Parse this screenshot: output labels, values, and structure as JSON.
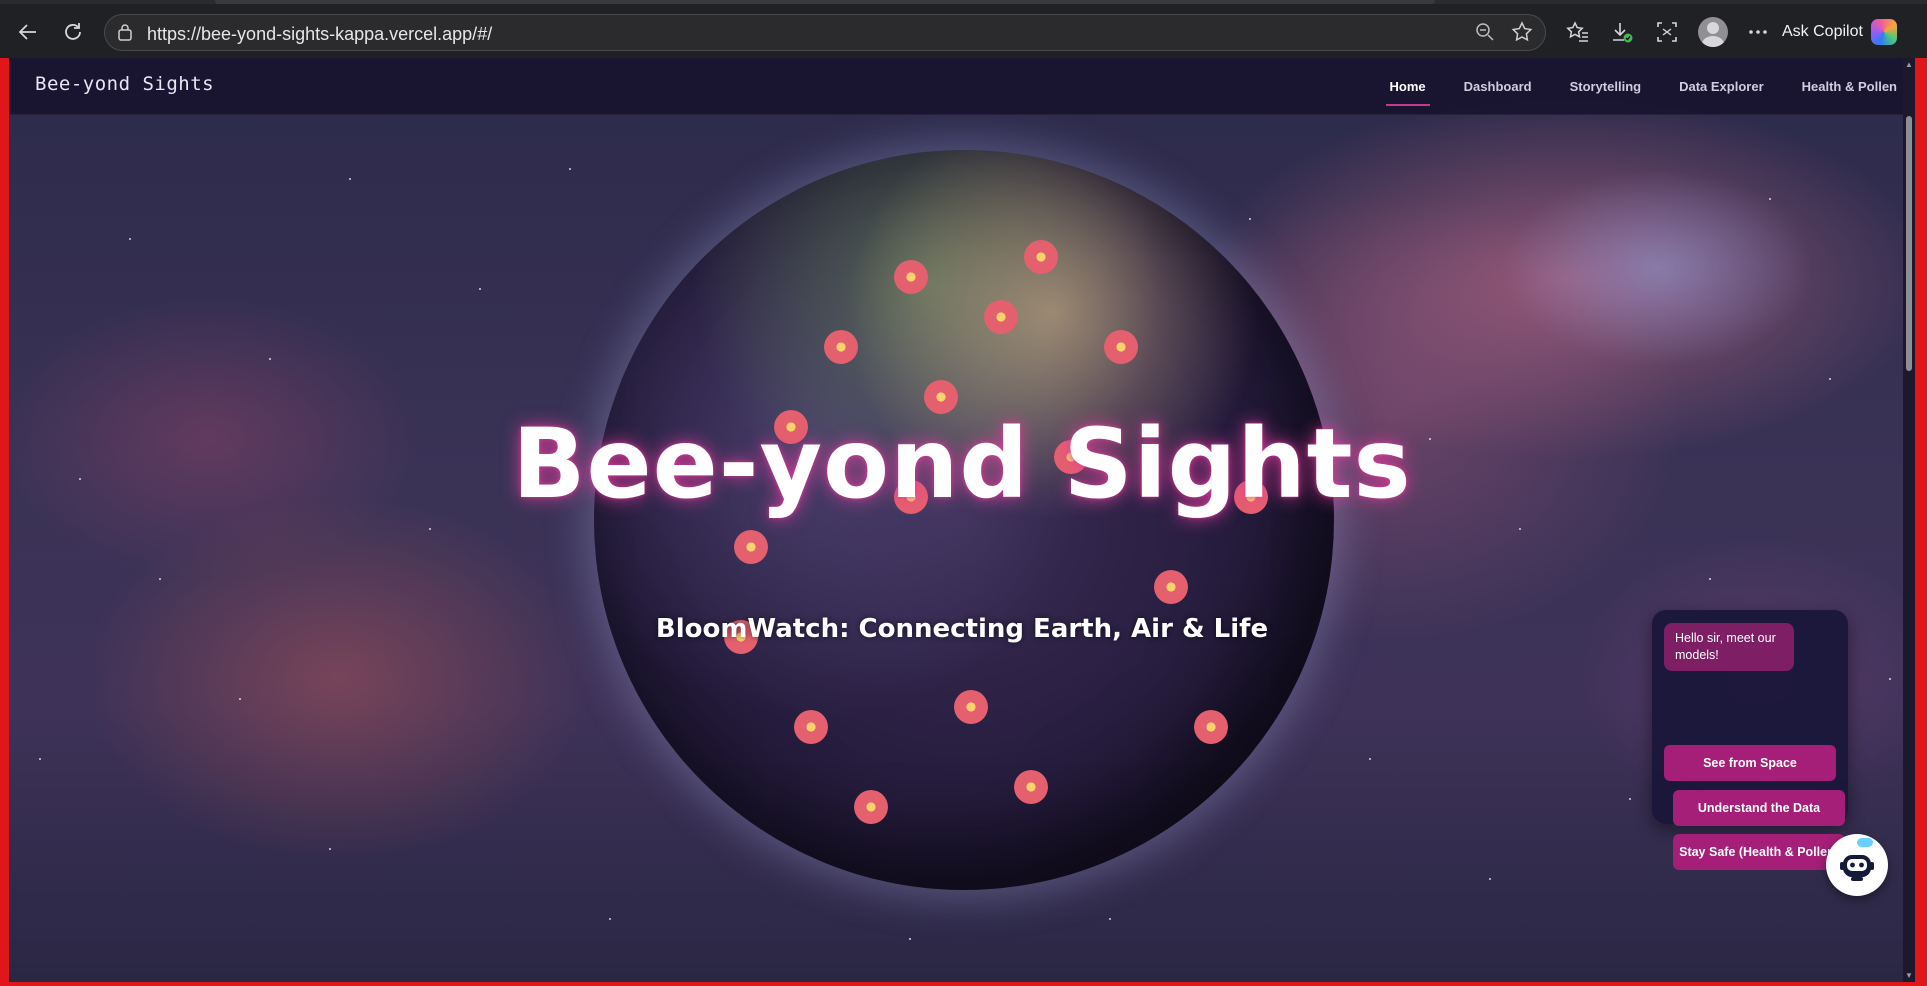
{
  "browser": {
    "url": "https://bee-yond-sights-kappa.vercel.app/#/",
    "copilot_label": "Ask Copilot"
  },
  "navbar": {
    "brand": "Bee-yond Sights",
    "links": [
      {
        "label": "Home",
        "active": true
      },
      {
        "label": "Dashboard",
        "active": false
      },
      {
        "label": "Storytelling",
        "active": false
      },
      {
        "label": "Data Explorer",
        "active": false
      },
      {
        "label": "Health & Pollen",
        "active": false
      }
    ]
  },
  "hero": {
    "title": "Bee-yond Sights",
    "subtitle": "BloomWatch: Connecting Earth, Air & Life"
  },
  "chat": {
    "greeting": "Hello sir, meet our models!",
    "options": [
      "See from Space",
      "Understand the Data",
      "Stay Safe (Health & Pollen)"
    ]
  },
  "colors": {
    "accent": "#a51e77",
    "nav_underline": "#c23a8b",
    "glow": "#e63ca0"
  }
}
